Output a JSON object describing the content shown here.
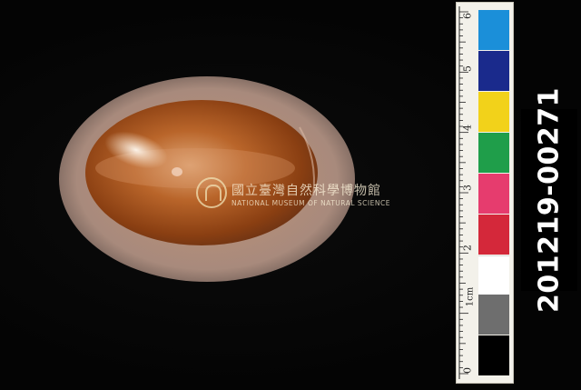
{
  "watermark": {
    "chinese": "國立臺灣自然科學博物館",
    "english": "NATIONAL MUSEUM OF NATURAL SCIENCE"
  },
  "specimen_id": "201219-00271",
  "ruler": {
    "unit_label": "1cm",
    "numbers": [
      "0",
      "1",
      "2",
      "3",
      "4",
      "5",
      "6"
    ],
    "swatches": [
      "#000000",
      "#6e6e6e",
      "#ffffff",
      "#d4283a",
      "#e63c6e",
      "#1f9e4a",
      "#f2d21a",
      "#1a2a8c",
      "#1b8fd9"
    ]
  },
  "colors": {
    "background": "#050505",
    "shell_rim": "#b89a86",
    "shell_body": "#a0541c"
  }
}
